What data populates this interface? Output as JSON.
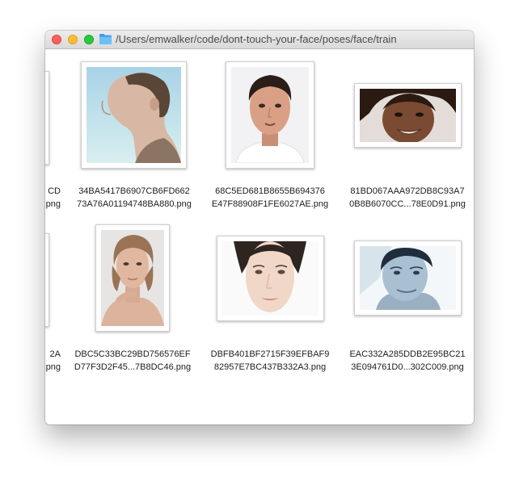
{
  "window": {
    "title": "/Users/emwalker/code/dont-touch-your-face/poses/face/train",
    "title_icon": "folder-icon",
    "buttons": [
      "close-button",
      "minimize-button",
      "zoom-button"
    ],
    "colors": {
      "close": "#fe5f57",
      "minimize": "#febc2e",
      "zoom": "#28c840",
      "folder": "#5fb6f5"
    }
  },
  "files": [
    {
      "line1": "CD",
      "line2": "png",
      "partial": true
    },
    {
      "line1": "34BA5417B6907CB6FD662",
      "line2": "73A76A01194748BA880.png"
    },
    {
      "line1": "68C5ED681B8655B694376",
      "line2": "E47F88908F1FE6027AE.png"
    },
    {
      "line1": "81BD067AAA972DB8C93A7",
      "line2": "0B8B6070CC...78E0D91.png"
    },
    {
      "line1": "2A",
      "line2": "png",
      "partial": true
    },
    {
      "line1": "DBC5C33BC29BD756576EF",
      "line2": "D77F3D2F45...7B8DC46.png"
    },
    {
      "line1": "DBFB401BF2715F39EFBAF9",
      "line2": "82957E7BC437B332A3.png"
    },
    {
      "line1": "EAC332A285DDB2E95BC21",
      "line2": "3E094761D0...302C009.png"
    }
  ],
  "scrollbar": {
    "horizontal_position": 0.5
  }
}
